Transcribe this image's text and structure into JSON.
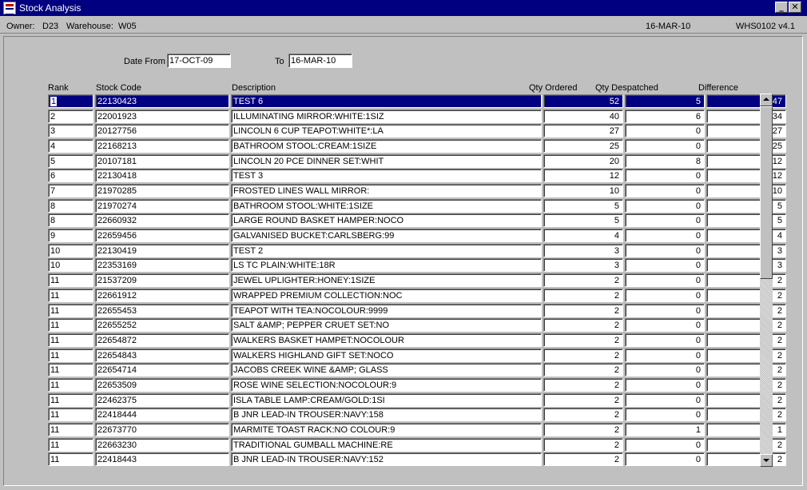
{
  "window": {
    "title": "Stock Analysis",
    "minimize_label": "_",
    "close_label": "✕"
  },
  "info": {
    "owner_label": "Owner:",
    "owner": "D23",
    "warehouse_label": "Warehouse:",
    "warehouse": "W05",
    "date": "16-MAR-10",
    "version": "WHS0102  v4.1"
  },
  "filters": {
    "date_from_label": "Date From",
    "date_from": "17-OCT-09",
    "to_label": "To",
    "to": "16-MAR-10"
  },
  "columns": {
    "rank": "Rank",
    "stock_code": "Stock Code",
    "description": "Description",
    "qty_ordered": "Qty Ordered",
    "qty_despatched": "Qty Despatched",
    "difference": "Difference"
  },
  "rows": [
    {
      "rank": "1",
      "code": "22130423",
      "desc": "TEST 6",
      "ordered": "52",
      "despatched": "5",
      "diff": "47"
    },
    {
      "rank": "2",
      "code": "22001923",
      "desc": "ILLUMINATING MIRROR:WHITE:1SIZ",
      "ordered": "40",
      "despatched": "6",
      "diff": "34"
    },
    {
      "rank": "3",
      "code": "20127756",
      "desc": "LINCOLN 6 CUP TEAPOT:WHITE*:LA",
      "ordered": "27",
      "despatched": "0",
      "diff": "27"
    },
    {
      "rank": "4",
      "code": "22168213",
      "desc": "BATHROOM STOOL:CREAM:1SIZE",
      "ordered": "25",
      "despatched": "0",
      "diff": "25"
    },
    {
      "rank": "5",
      "code": "20107181",
      "desc": "LINCOLN 20 PCE DINNER SET:WHIT",
      "ordered": "20",
      "despatched": "8",
      "diff": "12"
    },
    {
      "rank": "6",
      "code": "22130418",
      "desc": "TEST 3",
      "ordered": "12",
      "despatched": "0",
      "diff": "12"
    },
    {
      "rank": "7",
      "code": "21970285",
      "desc": "FROSTED LINES WALL MIRROR:",
      "ordered": "10",
      "despatched": "0",
      "diff": "10"
    },
    {
      "rank": "8",
      "code": "21970274",
      "desc": "BATHROOM STOOL:WHITE:1SIZE",
      "ordered": "5",
      "despatched": "0",
      "diff": "5"
    },
    {
      "rank": "8",
      "code": "22660932",
      "desc": "LARGE ROUND BASKET HAMPER:NOCO",
      "ordered": "5",
      "despatched": "0",
      "diff": "5"
    },
    {
      "rank": "9",
      "code": "22659456",
      "desc": "GALVANISED BUCKET:CARLSBERG:99",
      "ordered": "4",
      "despatched": "0",
      "diff": "4"
    },
    {
      "rank": "10",
      "code": "22130419",
      "desc": "TEST 2",
      "ordered": "3",
      "despatched": "0",
      "diff": "3"
    },
    {
      "rank": "10",
      "code": "22353169",
      "desc": "LS TC PLAIN:WHITE:18R",
      "ordered": "3",
      "despatched": "0",
      "diff": "3"
    },
    {
      "rank": "11",
      "code": "21537209",
      "desc": "JEWEL UPLIGHTER:HONEY:1SIZE",
      "ordered": "2",
      "despatched": "0",
      "diff": "2"
    },
    {
      "rank": "11",
      "code": "22661912",
      "desc": "WRAPPED PREMIUM COLLECTION:NOC",
      "ordered": "2",
      "despatched": "0",
      "diff": "2"
    },
    {
      "rank": "11",
      "code": "22655453",
      "desc": "TEAPOT WITH TEA:NOCOLOUR:9999",
      "ordered": "2",
      "despatched": "0",
      "diff": "2"
    },
    {
      "rank": "11",
      "code": "22655252",
      "desc": "SALT &AMP; PEPPER CRUET SET:NO",
      "ordered": "2",
      "despatched": "0",
      "diff": "2"
    },
    {
      "rank": "11",
      "code": "22654872",
      "desc": "WALKERS BASKET HAMPET:NOCOLOUR",
      "ordered": "2",
      "despatched": "0",
      "diff": "2"
    },
    {
      "rank": "11",
      "code": "22654843",
      "desc": "WALKERS HIGHLAND GIFT SET:NOCO",
      "ordered": "2",
      "despatched": "0",
      "diff": "2"
    },
    {
      "rank": "11",
      "code": "22654714",
      "desc": "JACOBS CREEK WINE &AMP; GLASS",
      "ordered": "2",
      "despatched": "0",
      "diff": "2"
    },
    {
      "rank": "11",
      "code": "22653509",
      "desc": "ROSE WINE SELECTION:NOCOLOUR:9",
      "ordered": "2",
      "despatched": "0",
      "diff": "2"
    },
    {
      "rank": "11",
      "code": "22462375",
      "desc": "ISLA TABLE LAMP:CREAM/GOLD:1SI",
      "ordered": "2",
      "despatched": "0",
      "diff": "2"
    },
    {
      "rank": "11",
      "code": "22418444",
      "desc": "B JNR LEAD-IN TROUSER:NAVY:158",
      "ordered": "2",
      "despatched": "0",
      "diff": "2"
    },
    {
      "rank": "11",
      "code": "22673770",
      "desc": "MARMITE TOAST RACK:NO COLOUR:9",
      "ordered": "2",
      "despatched": "1",
      "diff": "1"
    },
    {
      "rank": "11",
      "code": "22663230",
      "desc": "TRADITIONAL GUMBALL MACHINE:RE",
      "ordered": "2",
      "despatched": "0",
      "diff": "2"
    },
    {
      "rank": "11",
      "code": "22418443",
      "desc": "B JNR LEAD-IN TROUSER:NAVY:152",
      "ordered": "2",
      "despatched": "0",
      "diff": "2"
    }
  ],
  "selected_row": 0,
  "colors": {
    "title_bar": "#000080",
    "selection": "#000080",
    "window_bg": "#c0c0c0"
  }
}
